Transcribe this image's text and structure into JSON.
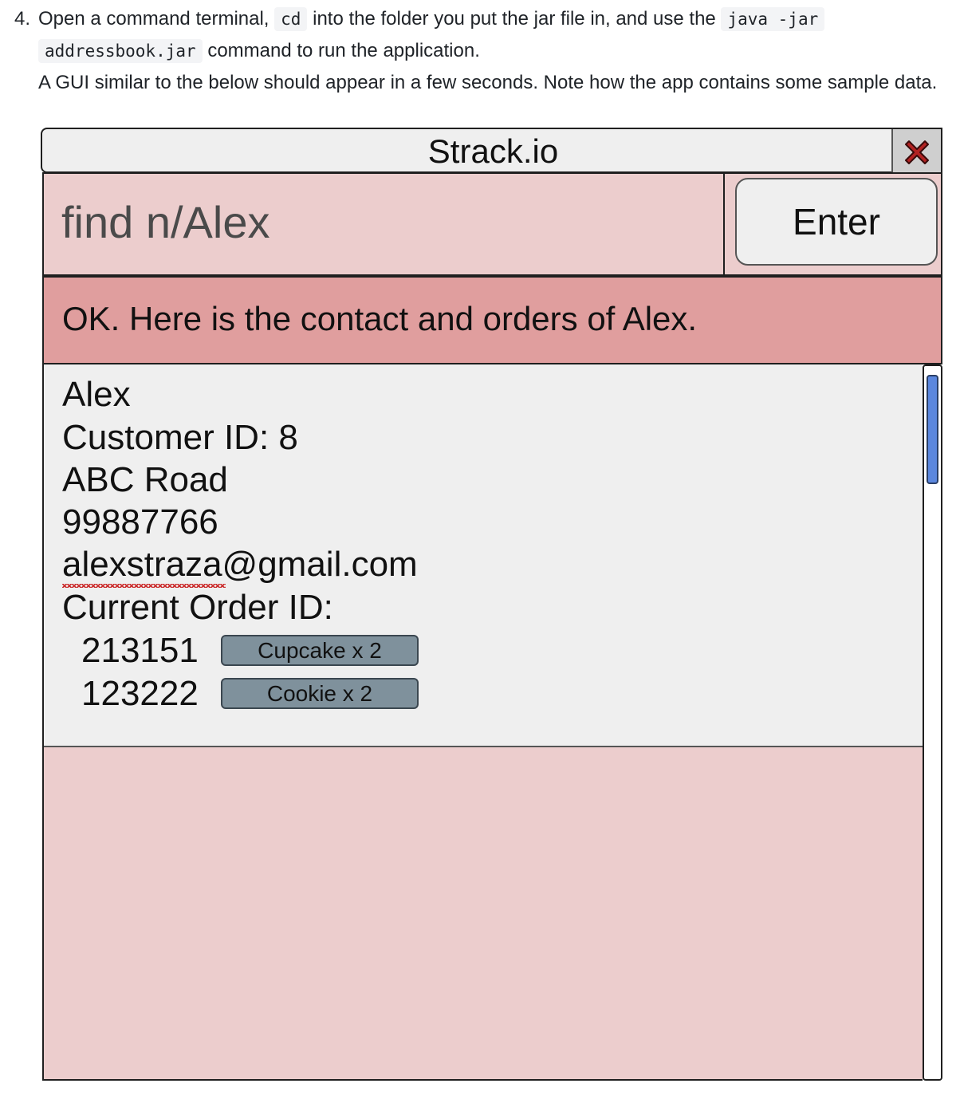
{
  "instructions": {
    "step_number": "4.",
    "line1_part1": "Open a command terminal,",
    "code_cd": "cd",
    "line1_part2": "into the folder you put the jar file in, and use the",
    "code_java": "java -jar",
    "code_jar": "addressbook.jar",
    "line2_part2": "command to run the application.",
    "line3": "A GUI similar to the below should appear in a few seconds. Note how the app contains some sample data."
  },
  "app": {
    "title": "Strack.io",
    "close_icon": "close-x-icon",
    "command_input_value": "find n/Alex",
    "enter_label": "Enter",
    "result_message": "OK. Here is the contact and orders of Alex.",
    "contact": {
      "name": "Alex",
      "customer_id": "Customer ID: 8",
      "address": "ABC Road",
      "phone": "99887766",
      "email": "alexstraza@gmail.com",
      "orders_label": "Current Order ID:",
      "orders": [
        {
          "id": "213151",
          "item": "Cupcake x 2"
        },
        {
          "id": "123222",
          "item": "Cookie x 2"
        }
      ]
    }
  },
  "colors": {
    "input_bg": "#eccdcd",
    "result_bg": "#e09e9e",
    "card_bg": "#efefef",
    "chip_bg": "#7f919c",
    "scroll_thumb": "#5b87de",
    "close_x": "#b22222"
  }
}
